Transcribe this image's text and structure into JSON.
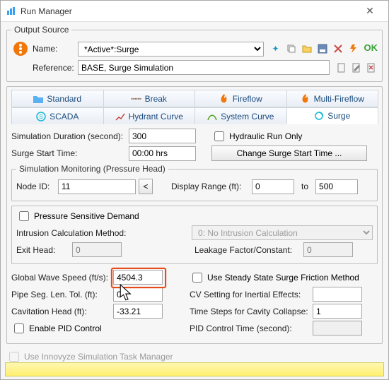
{
  "window_title": "Run Manager",
  "output_source": {
    "legend": "Output Source",
    "name_label": "Name:",
    "name_value": "*Active*:Surge",
    "reference_label": "Reference:",
    "reference_value": "BASE, Surge Simulation",
    "ok_label": "OK"
  },
  "tabs_row1": [
    {
      "label": "Standard",
      "icon": "folder"
    },
    {
      "label": "Break",
      "icon": "break"
    },
    {
      "label": "Fireflow",
      "icon": "fire"
    },
    {
      "label": "Multi-Fireflow",
      "icon": "fire"
    }
  ],
  "tabs_row2": [
    {
      "label": "SCADA",
      "icon": "s"
    },
    {
      "label": "Hydrant Curve",
      "icon": "chart"
    },
    {
      "label": "System Curve",
      "icon": "chart"
    },
    {
      "label": "Surge",
      "icon": "cycle"
    }
  ],
  "active_tab": "Surge",
  "sim_duration_label": "Simulation Duration (second):",
  "sim_duration_value": "300",
  "hydraulic_run_only": "Hydraulic Run Only",
  "surge_start_label": "Surge Start Time:",
  "surge_start_value": "00:00 hrs",
  "change_surge_btn": "Change Surge Start Time ...",
  "monitoring_legend": "Simulation Monitoring (Pressure Head)",
  "node_id_label": "Node ID:",
  "node_id_value": "11",
  "display_range_label": "Display Range (ft):",
  "display_range_from": "0",
  "display_range_to_label": "to",
  "display_range_to": "500",
  "psd_label": "Pressure Sensitive Demand",
  "icm_label": "Intrusion Calculation Method:",
  "icm_value": "0: No Intrusion Calculation",
  "exit_head_label": "Exit Head:",
  "exit_head_value": "0",
  "leakage_label": "Leakage Factor/Constant:",
  "leakage_value": "0",
  "gws_label": "Global Wave Speed (ft/s):",
  "gws_value": "4504.3",
  "pipe_seg_label": "Pipe Seg. Len. Tol. (ft):",
  "pipe_seg_value": "0",
  "cav_head_label": "Cavitation Head (ft):",
  "cav_head_value": "-33.21",
  "enable_pid_label": "Enable PID Control",
  "steady_state_label": "Use Steady State Surge Friction Method",
  "cv_setting_label": "CV Setting for Inertial Effects:",
  "cv_setting_value": "",
  "time_steps_label": "Time Steps for Cavity Collapse:",
  "time_steps_value": "1",
  "pid_time_label": "PID Control Time (second):",
  "pid_time_value": "",
  "innovyze_label": "Use Innovyze Simulation Task Manager"
}
